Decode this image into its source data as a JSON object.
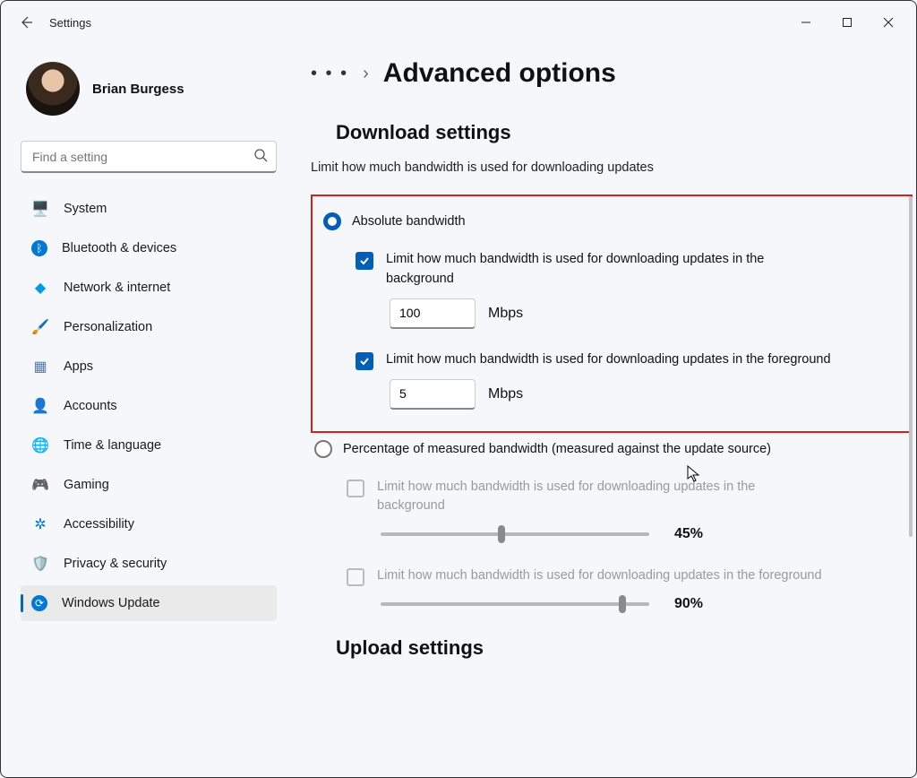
{
  "app_title": "Settings",
  "user": {
    "name": "Brian Burgess"
  },
  "search": {
    "placeholder": "Find a setting"
  },
  "nav": [
    {
      "icon": "🖥️",
      "color": "#0078d4",
      "label": "System"
    },
    {
      "icon": "ᛒ",
      "bg": "#0078d4",
      "label": "Bluetooth & devices"
    },
    {
      "icon": "◆",
      "color": "#0099e6",
      "label": "Network & internet"
    },
    {
      "icon": "🖌️",
      "color": "#d08040",
      "label": "Personalization"
    },
    {
      "icon": "▦",
      "color": "#5b7aa8",
      "label": "Apps"
    },
    {
      "icon": "👤",
      "color": "#2ea060",
      "label": "Accounts"
    },
    {
      "icon": "🌐",
      "color": "#3a78c8",
      "label": "Time & language"
    },
    {
      "icon": "🎮",
      "color": "#888",
      "label": "Gaming"
    },
    {
      "icon": "✲",
      "color": "#0078d4",
      "label": "Accessibility"
    },
    {
      "icon": "🛡️",
      "color": "#888",
      "label": "Privacy & security"
    },
    {
      "icon": "⟳",
      "bg": "#0078d4",
      "label": "Windows Update"
    }
  ],
  "breadcrumb": {
    "title": "Advanced options"
  },
  "download": {
    "heading": "Download settings",
    "subtitle": "Limit how much bandwidth is used for downloading updates",
    "absolute": {
      "label": "Absolute bandwidth",
      "bg": {
        "label": "Limit how much bandwidth is used for downloading updates in the background",
        "value": "100",
        "unit": "Mbps"
      },
      "fg": {
        "label": "Limit how much bandwidth is used for downloading updates in the foreground",
        "value": "5",
        "unit": "Mbps"
      }
    },
    "percentage": {
      "label": "Percentage of measured bandwidth (measured against the update source)",
      "bg": {
        "label": "Limit how much bandwidth is used for downloading updates in the background",
        "pct": "45%",
        "pos": 45
      },
      "fg": {
        "label": "Limit how much bandwidth is used for downloading updates in the foreground",
        "pct": "90%",
        "pos": 90
      }
    }
  },
  "upload": {
    "heading": "Upload settings"
  }
}
